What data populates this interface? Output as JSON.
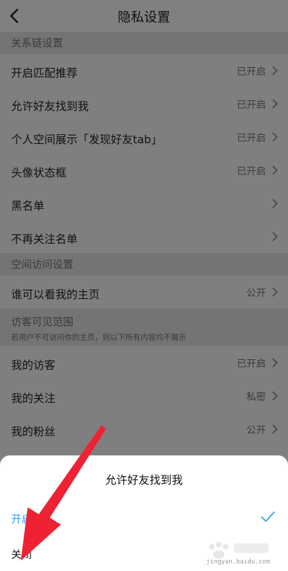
{
  "nav": {
    "title": "隐私设置",
    "back_icon": "chevron-left-icon"
  },
  "sections": [
    {
      "title": "关系链设置"
    },
    {
      "title": "空间访问设置"
    },
    {
      "title": "访客可见范围",
      "subtitle": "若用户不可访问你的主页，则以下所有内容均不展示"
    }
  ],
  "rows": [
    {
      "label": "开启匹配推荐",
      "value": "已开启"
    },
    {
      "label": "允许好友找到我",
      "value": "已开启"
    },
    {
      "label": "个人空间展示「发现好友tab」",
      "value": "已开启"
    },
    {
      "label": "头像状态框",
      "value": "已开启"
    },
    {
      "label": "黑名单",
      "value": ""
    },
    {
      "label": "不再关注名单",
      "value": ""
    },
    {
      "label": "谁可以看我的主页",
      "value": "公开"
    },
    {
      "label": "我的访客",
      "value": "已开启"
    },
    {
      "label": "我的关注",
      "value": "私密"
    },
    {
      "label": "我的粉丝",
      "value": "公开"
    }
  ],
  "sheet": {
    "title": "允许好友找到我",
    "option_on": "开启",
    "option_off": "关闭",
    "selected": "开启"
  },
  "watermark": {
    "text": "jingyan.baidu.com"
  },
  "colors": {
    "accent": "#2aa4f4",
    "arrow": "#ee2233"
  }
}
